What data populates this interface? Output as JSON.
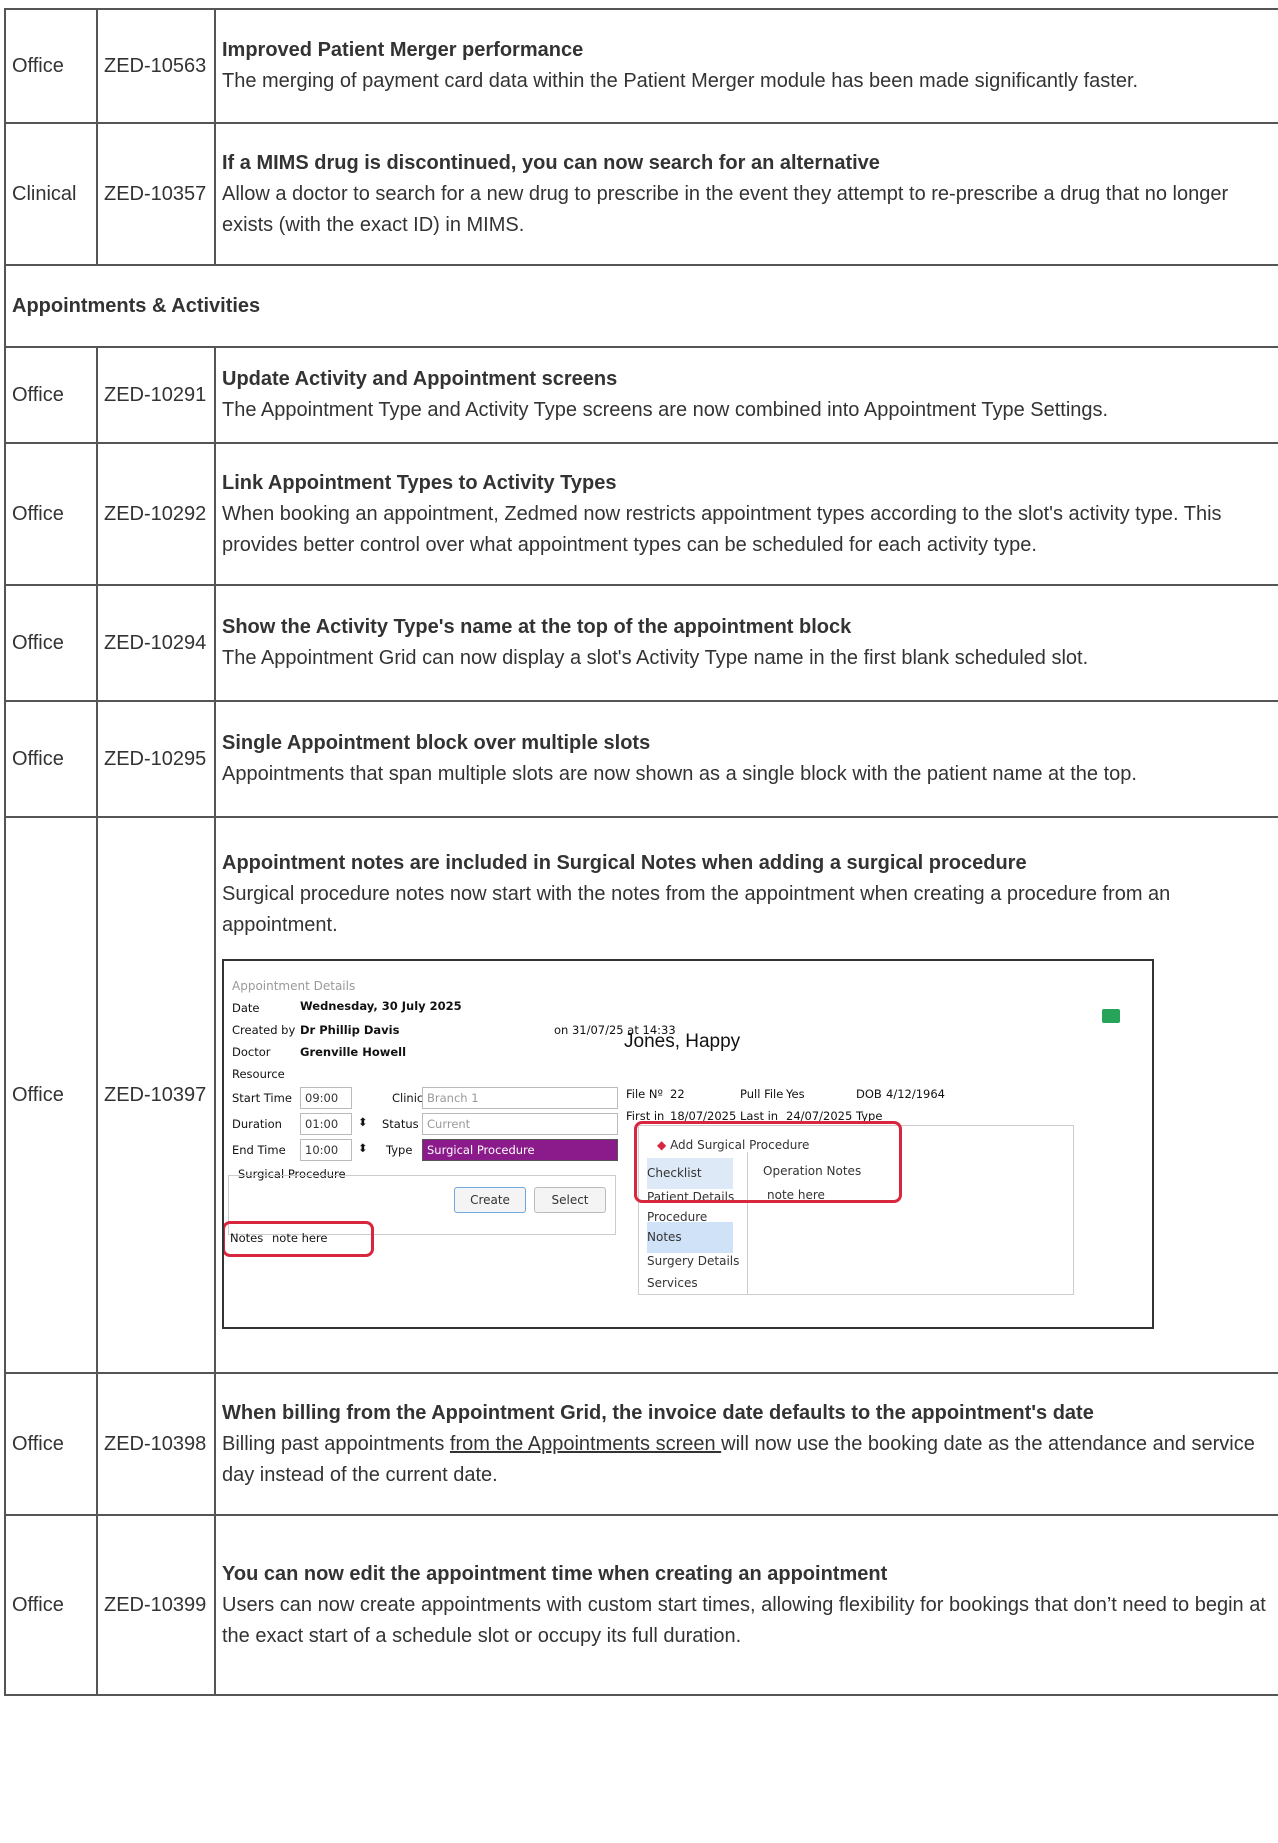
{
  "rows_top": [
    {
      "category": "Office",
      "id": "ZED-10563",
      "title": "Improved Patient Merger performance",
      "body": "The merging of payment card data within the Patient Merger module has been made significantly faster."
    },
    {
      "category": "Clinical",
      "id": "ZED-10357",
      "title": "If a MIMS drug is discontinued, you can now search for an alternative",
      "body": "Allow a doctor to search for a new drug to prescribe in the event they attempt to re-prescribe a drug that no longer exists (with the exact ID) in MIMS."
    }
  ],
  "section_heading": "Appointments & Activities",
  "rows": [
    {
      "category": "Office",
      "id": "ZED-10291",
      "title": "Update Activity and Appointment screens",
      "body": "The Appointment Type and Activity Type screens are now combined into Appointment Type Settings."
    },
    {
      "category": "Office",
      "id": "ZED-10292",
      "title": "Link Appointment Types to Activity Types",
      "body": "When booking an appointment, Zedmed now restricts appointment types according to the slot's activity type. This provides better control over what appointment types can be scheduled for each activity type."
    },
    {
      "category": "Office",
      "id": "ZED-10294",
      "title": "Show the Activity Type's name at the top of the appointment block",
      "body": "The Appointment Grid can now display a slot's Activity Type name in the first blank scheduled slot."
    },
    {
      "category": "Office",
      "id": "ZED-10295",
      "title": "Single Appointment block over multiple slots",
      "body": "Appointments that span multiple slots are now shown as a single block with the patient name at the top."
    },
    {
      "category": "Office",
      "id": "ZED-10397",
      "title": "Appointment notes are included in Surgical Notes when adding a surgical procedure",
      "body": "Surgical procedure notes now start with the notes from the appointment when creating a procedure from an appointment."
    },
    {
      "category": "Office",
      "id": "ZED-10398",
      "title": "When billing from the Appointment Grid, the invoice date defaults to the appointment's date",
      "body_pre": "Billing past appointments ",
      "body_link": "from the Appointments screen ",
      "body_post": "will now use the booking date as the attendance and service day instead of the current date."
    },
    {
      "category": "Office",
      "id": "ZED-10399",
      "title": "You can now edit the appointment time when creating an appointment",
      "body": "Users can now create appointments with custom start times, allowing flexibility for bookings that don’t need to begin at the exact start of a schedule slot or occupy its full duration."
    }
  ],
  "screenshot": {
    "window_title": "Appointment Details",
    "date_label": "Date",
    "date_value": "Wednesday, 30 July 2025",
    "created_label": "Created by",
    "created_value": "Dr Phillip Davis",
    "created_on": "on 31/07/25 at 14:33",
    "doctor_label": "Doctor",
    "doctor_value": "Grenville Howell",
    "resource_label": "Resource",
    "start_label": "Start Time",
    "start_value": "09:00",
    "clinic_label": "Clinic",
    "clinic_value": "Branch 1",
    "duration_label": "Duration",
    "duration_value": "01:00",
    "status_label": "Status",
    "status_value": "Current",
    "end_label": "End Time",
    "end_value": "10:00",
    "type_label": "Type",
    "type_value": "Surgical Procedure",
    "group_label": "Surgical Procedure",
    "create_btn": "Create",
    "select_btn": "Select",
    "notes_label": "Notes",
    "notes_value": "note here",
    "patient_name": "Jones, Happy",
    "file_label": "File Nº",
    "file_value": "22",
    "pull_label": "Pull File",
    "pull_value": "Yes",
    "dob_label": "DOB",
    "dob_value": "4/12/1964",
    "first_label": "First in",
    "first_value": "18/07/2025",
    "last_label": "Last in",
    "last_value": "24/07/2025",
    "type2_label": "Type",
    "popup_title": "Add Surgical Procedure",
    "popup_items": [
      "Checklist",
      "Patient Details",
      "Procedure",
      "Notes",
      "Surgery Details",
      "Services"
    ],
    "op_notes_label": "Operation Notes",
    "op_notes_value": "note here",
    "type_color": "#8b1a8b",
    "accent_red": "#d7263d",
    "check_color": "#27a35a"
  }
}
